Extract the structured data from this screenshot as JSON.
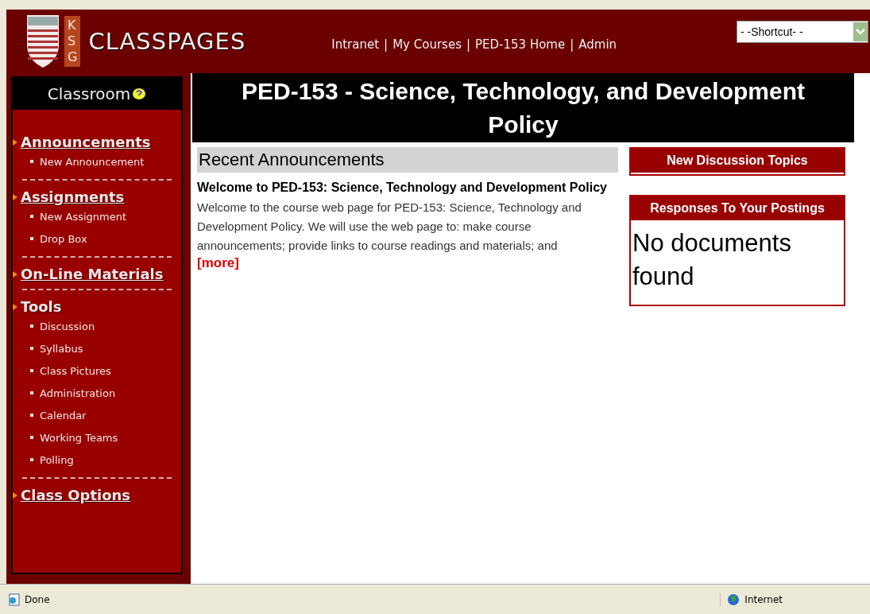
{
  "header": {
    "logo_letters": [
      "K",
      "S",
      "G"
    ],
    "site_title": "CLASSPAGES",
    "nav": [
      "Intranet",
      "My Courses",
      "PED-153 Home",
      "Admin"
    ],
    "nav_separator": "|",
    "shortcut": {
      "value": "- -Shortcut- -"
    }
  },
  "sidebar": {
    "title": "Classroom",
    "sections": [
      {
        "label": "Announcements",
        "kind": "link",
        "items": [
          "New Announcement"
        ]
      },
      {
        "label": "Assignments",
        "kind": "link",
        "items": [
          "New Assignment",
          "Drop Box"
        ]
      },
      {
        "label": "On-Line Materials",
        "kind": "link"
      },
      {
        "label": "Tools",
        "kind": "heading",
        "items": [
          "Discussion",
          "Syllabus",
          "Class Pictures",
          "Administration",
          "Calendar",
          "Working Teams",
          "Polling"
        ]
      },
      {
        "label": "Class Options",
        "kind": "link"
      }
    ]
  },
  "main": {
    "title": "PED-153 - Science, Technology, and Development Policy",
    "announcements": {
      "heading": "Recent Announcements",
      "items": [
        {
          "title": "Welcome to PED-153: Science, Technology and Development Policy",
          "body": "Welcome to the course web page for PED-153: Science, Technology and Development Policy. We will use the web page to: make course announcements; provide links to course readings and materials; and",
          "more": "[more]"
        }
      ]
    },
    "panels": [
      {
        "title": "New Discussion Topics"
      },
      {
        "title": "Responses To Your Postings",
        "body": "No documents found"
      }
    ]
  },
  "status_bar": {
    "status": "Done",
    "zone": "Internet"
  }
}
